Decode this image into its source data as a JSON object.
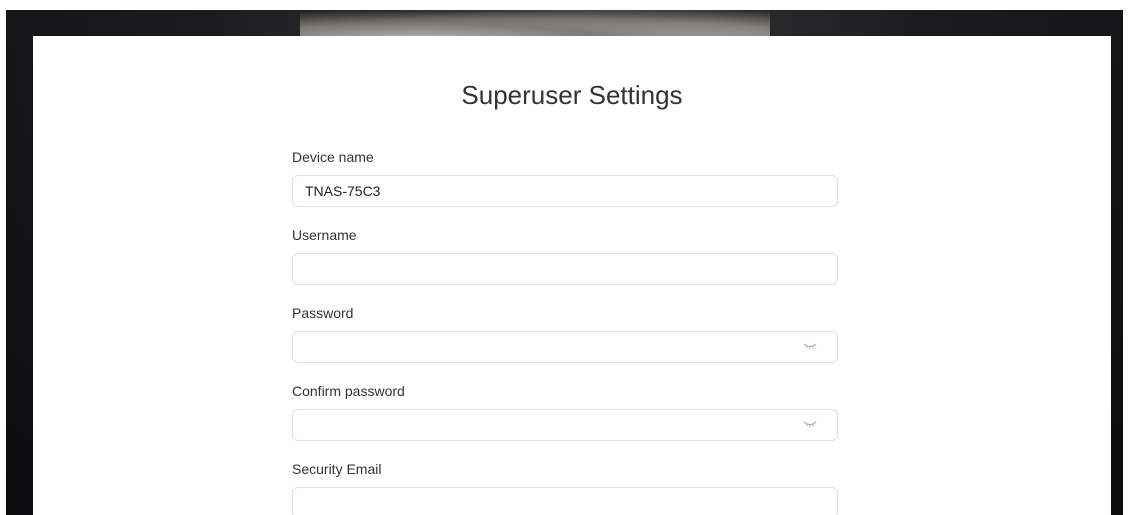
{
  "page": {
    "title": "Superuser Settings"
  },
  "form": {
    "device_name": {
      "label": "Device name",
      "value": "TNAS-75C3",
      "placeholder": ""
    },
    "username": {
      "label": "Username",
      "value": "",
      "placeholder": ""
    },
    "password": {
      "label": "Password",
      "value": "",
      "placeholder": "",
      "toggle_icon": "eye-closed-icon"
    },
    "confirm_password": {
      "label": "Confirm password",
      "value": "",
      "placeholder": "",
      "toggle_icon": "eye-closed-icon"
    },
    "security_email": {
      "label": "Security Email",
      "value": "",
      "placeholder": ""
    }
  },
  "colors": {
    "background": "#1c1c1e",
    "card": "#ffffff",
    "input_border": "#dcdfe6",
    "text": "#333333"
  }
}
